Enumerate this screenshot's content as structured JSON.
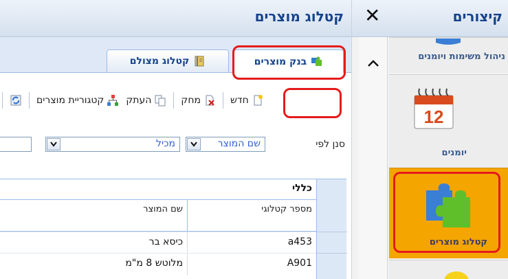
{
  "main": {
    "title": "קטלוג מוצרים",
    "tabs": [
      {
        "label": "בנק מוצרים",
        "icon": "puzzle-icon",
        "active": true
      },
      {
        "label": "קטלוג מצולם",
        "icon": "book-icon",
        "active": false
      }
    ],
    "toolbar": {
      "new_label": "חדש",
      "delete_label": "מחק",
      "copy_label": "העתק",
      "category_label": "קטגוריית מוצרים"
    },
    "filter": {
      "label": "סנן לפי",
      "field_value": "שם המוצר",
      "operator_value": "מכיל",
      "search_value": ""
    },
    "grid": {
      "group_label": "כללי",
      "columns": [
        "מספר קטלוגי",
        "שם המוצר"
      ],
      "rows": [
        {
          "catalog": "a453",
          "name": "כיסא בר"
        },
        {
          "catalog": "A901",
          "name": "מלוטש 8 מ\"מ"
        }
      ]
    }
  },
  "side": {
    "title": "קיצורים",
    "close_glyph": "✕",
    "shortcuts": [
      {
        "label": "ניהול משימות ויומנים",
        "icon": "tasks-icon"
      },
      {
        "label": "יומנים",
        "icon": "calendar-icon",
        "calendar_day": "12"
      },
      {
        "label": "קטלוג מוצרים",
        "icon": "puzzle-icon",
        "selected": true
      }
    ]
  },
  "colors": {
    "header_text": "#15428b",
    "highlight": "#e41b1b",
    "selected_shortcut": "#f5a500",
    "link_blue": "#2e5fd4"
  }
}
